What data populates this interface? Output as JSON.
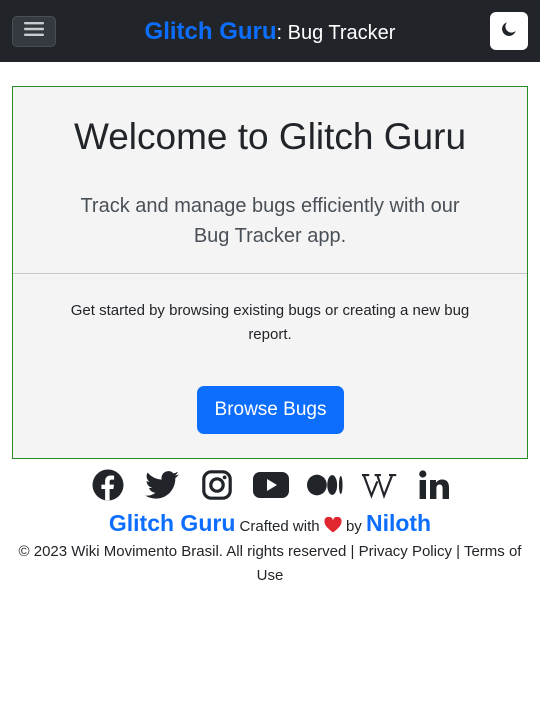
{
  "navbar": {
    "brand_name": "Glitch Guru",
    "brand_sub": ": Bug Tracker",
    "menu_icon": "hamburger-icon",
    "theme_icon": "moon-icon"
  },
  "hero": {
    "title": "Welcome to Glitch Guru",
    "lead": "Track and manage bugs efficiently with our Bug Tracker app.",
    "text": "Get started by browsing existing bugs or creating a new bug report.",
    "button_label": "Browse Bugs"
  },
  "footer": {
    "social_icons": [
      "facebook-icon",
      "twitter-icon",
      "instagram-icon",
      "youtube-icon",
      "medium-icon",
      "wikipedia-icon",
      "linkedin-icon"
    ],
    "brand": "Glitch Guru",
    "crafted_with": "Crafted with",
    "by": "by",
    "author": "Niloth",
    "copyright": "© 2023 Wiki Movimento Brasil. All rights reserved",
    "separator": "|",
    "privacy": "Privacy Policy",
    "terms": "Terms of Use"
  },
  "colors": {
    "navbar_bg": "#212529",
    "brand_blue": "#0d6efd",
    "hero_bg": "#f4f4f4",
    "hero_border": "#2a8a2a",
    "heart": "#e0262f"
  }
}
